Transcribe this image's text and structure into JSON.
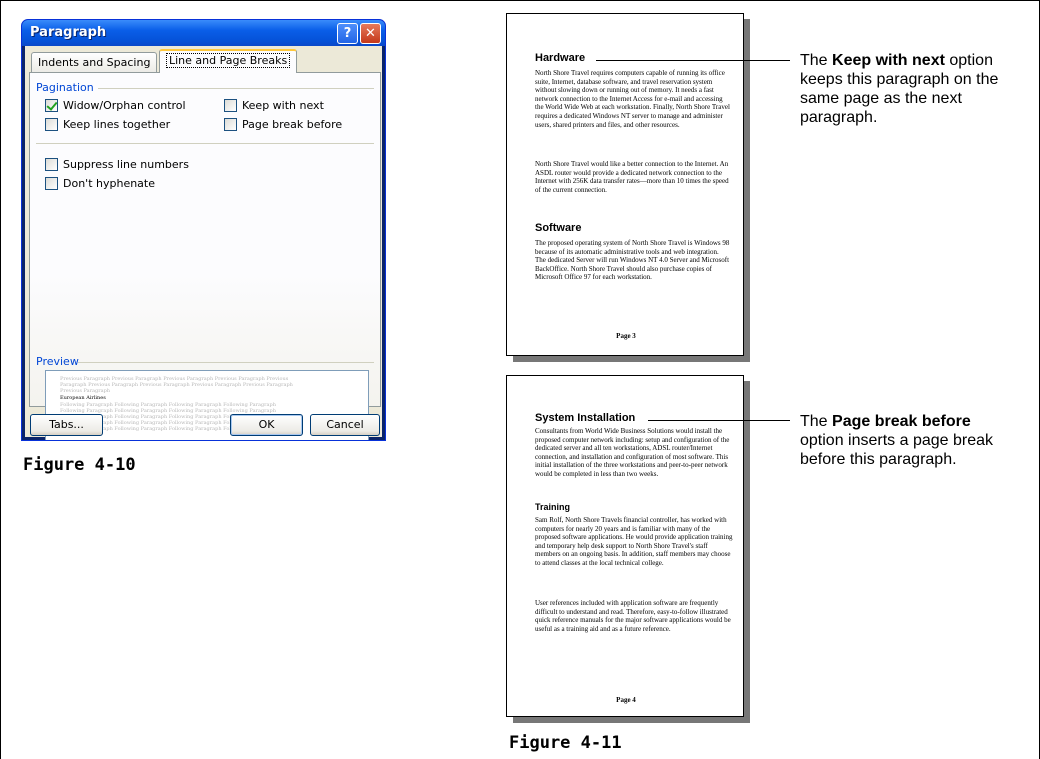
{
  "dialog": {
    "title": "Paragraph",
    "help_button": "?",
    "close_button": "✕",
    "tabs": [
      {
        "label": "Indents and Spacing",
        "active": false
      },
      {
        "label": "Line and Page Breaks",
        "active": true
      }
    ],
    "pagination": {
      "label": "Pagination",
      "widow_orphan": {
        "label": "Widow/Orphan control",
        "checked": true
      },
      "keep_with_next": {
        "label": "Keep with next",
        "checked": false
      },
      "keep_lines_together": {
        "label": "Keep lines together",
        "checked": false
      },
      "page_break_before": {
        "label": "Page break before",
        "checked": false
      }
    },
    "suppress_line_numbers": {
      "label": "Suppress line numbers",
      "checked": false
    },
    "dont_hyphenate": {
      "label": "Don't hyphenate",
      "checked": false
    },
    "preview": {
      "label": "Preview",
      "previous_lines": [
        "Previous Paragraph Previous Paragraph Previous Paragraph Previous Paragraph Previous",
        "Paragraph Previous Paragraph Previous Paragraph Previous Paragraph Previous Paragraph",
        "Previous Paragraph"
      ],
      "current_line": "European Airlines",
      "following_lines": [
        "Following Paragraph Following Paragraph Following Paragraph Following Paragraph",
        "Following Paragraph Following Paragraph Following Paragraph Following Paragraph",
        "Following Paragraph Following Paragraph Following Paragraph Following Paragraph",
        "Following Paragraph Following Paragraph Following Paragraph Following Paragraph",
        "Following Paragraph Following Paragraph Following Paragraph Following Paragraph"
      ]
    },
    "tabs_button": "Tabs...",
    "ok_button": "OK",
    "cancel_button": "Cancel"
  },
  "figure_left_caption": "Figure 4-10",
  "figure_right_caption": "Figure 4-11",
  "page3": {
    "heading1": "Hardware",
    "para1": "North Shore Travel requires computers capable of running its office suite, Internet, database software, and travel reservation system without slowing down or running out of memory. It needs a fast network connection to the Internet Access for e-mail and accessing the World Wide Web at each workstation. Finally, North Shore Travel requires a dedicated Windows NT server to manage and administer users, shared printers and files, and other resources.",
    "para2": "North Shore Travel would like a better connection to the Internet. An ASDL router would provide a dedicated network connection to the Internet with 256K data transfer rates—more than 10 times the speed of the current connection.",
    "heading2": "Software",
    "para3": "The proposed operating system of North Shore Travel is Windows 98 because of its automatic administrative tools and web integration. The dedicated Server will run Windows NT 4.0 Server and Microsoft BackOffice. North Shore Travel should also purchase copies of Microsoft Office 97 for each workstation.",
    "page_number": "Page 3"
  },
  "page4": {
    "heading1": "System Installation",
    "para1": "Consultants from World Wide Business Solutions would install the proposed computer network including: setup and configuration of the dedicated server and all ten workstations, ADSL router/Internet connection, and installation and configuration of most software. This initial installation of the three workstations and peer-to-peer network would be completed in less than two weeks.",
    "heading2": "Training",
    "para2": "Sam Rolf, North Shore Travels financial controller, has worked with computers for nearly 20 years and is familiar with many of the proposed software applications. He would provide application training and temporary help desk support to North Shore Travel's staff members on an ongoing basis. In addition, staff members may choose to attend classes at the local technical college.",
    "para3": "User references included with application software are frequently difficult to understand and read. Therefore, easy-to-follow illustrated quick reference manuals for the major software applications would be useful as a training aid and as a future reference.",
    "page_number": "Page 4"
  },
  "callout_top": {
    "prefix": "The ",
    "bold": "Keep with next",
    "suffix": " option keeps this paragraph on the same page as the next paragraph."
  },
  "callout_bottom": {
    "prefix": "The ",
    "bold": "Page break before",
    "suffix": " option inserts a page break before this paragraph."
  }
}
